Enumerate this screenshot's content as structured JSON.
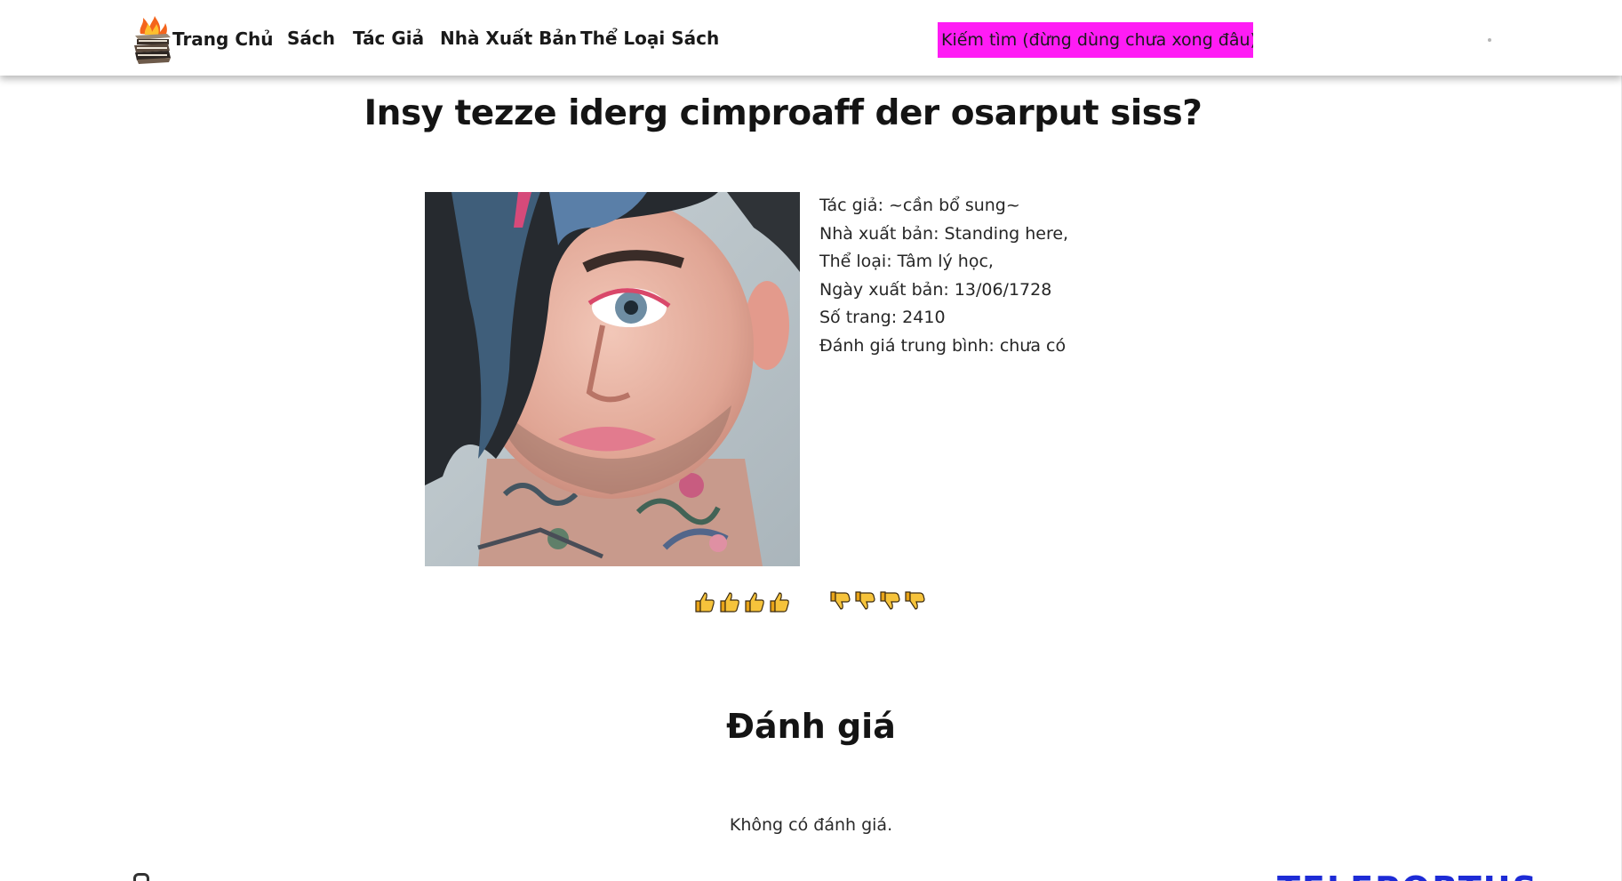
{
  "nav": {
    "brand_label": "Trang Chủ",
    "links": [
      "Sách",
      "Tác Giả",
      "Nhà Xuất Bản",
      "Thể Loại Sách"
    ],
    "search_label": "Kiếm tìm (đừng dùng chưa xong đâu)",
    "search_color": "#ff1cf5"
  },
  "book": {
    "title": "Insy tezze iderg cimproaff der osarput siss?",
    "info": [
      "Tác giả: ~cần bổ sung~",
      "Nhà xuất bản: Standing here,",
      "Thể loại: Tâm lý học,",
      "Ngày xuất bản: 13/06/1728",
      "Số trang: 2410",
      "Đánh giá trung bình: chưa có"
    ]
  },
  "votes": {
    "up_count_icons": 4,
    "down_count_icons": 4
  },
  "reviews": {
    "heading": "Đánh giá",
    "empty_text": "Không có đánh giá."
  },
  "footer": {
    "brand_text": "TELEPORTUS",
    "brand_color": "#1d2bd6"
  }
}
